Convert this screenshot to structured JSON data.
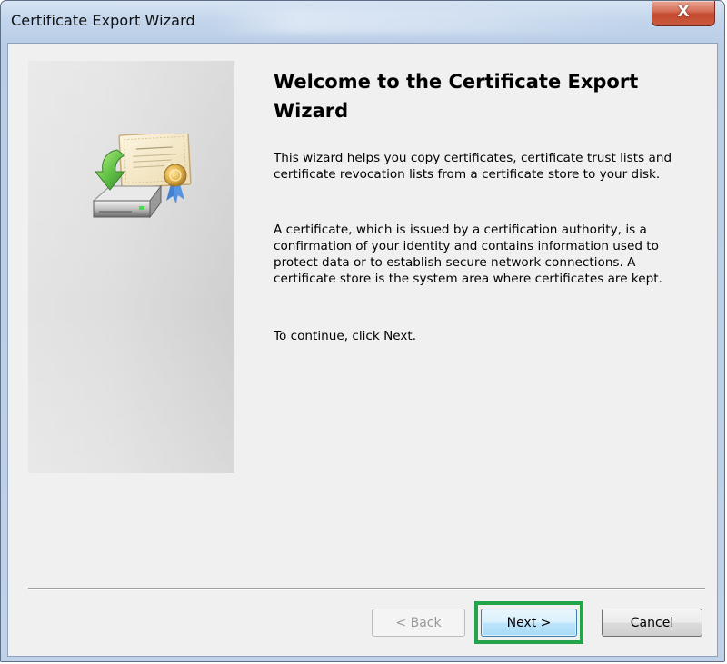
{
  "window": {
    "title": "Certificate Export Wizard",
    "close_glyph": "X"
  },
  "content": {
    "heading": "Welcome to the Certificate Export Wizard",
    "paragraph_1": "This wizard helps you copy certificates, certificate trust lists and certificate revocation lists from a certificate store to your disk.",
    "paragraph_2": "A certificate, which is issued by a certification authority, is a confirmation of your identity and contains information used to protect data or to establish secure network connections. A certificate store is the system area where certificates are kept.",
    "paragraph_3": "To continue, click Next."
  },
  "buttons": {
    "back_label": "< Back",
    "next_label": "Next >",
    "cancel_label": "Cancel",
    "back_enabled": false
  },
  "icons": {
    "wizard_art": "certificate-disk-export-icon",
    "close": "close-icon"
  },
  "colors": {
    "highlight": "#23a34a",
    "close_button": "#c44a2f",
    "next_button_border": "#3c7fb1"
  }
}
